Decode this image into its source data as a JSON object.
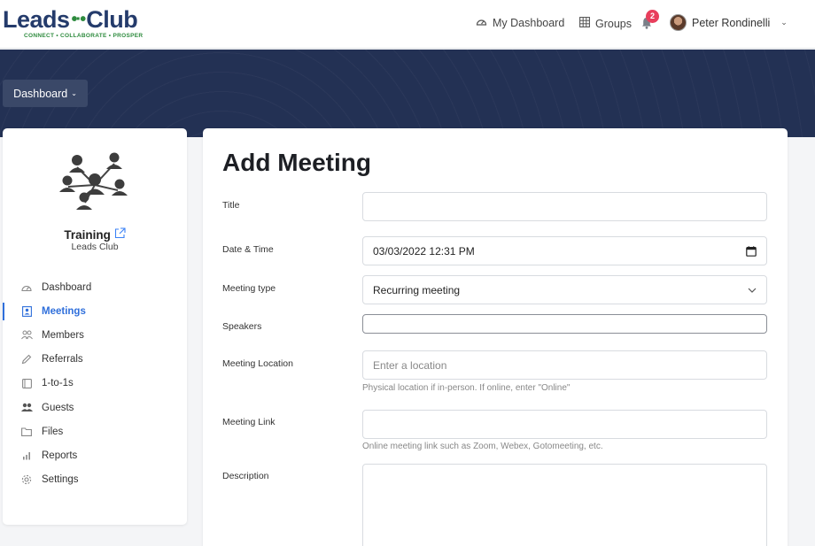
{
  "brand": {
    "name_left": "Leads",
    "name_right": "Club",
    "tagline": "CONNECT • COLLABORATE • PROSPER"
  },
  "topnav": {
    "dashboard_label": "My Dashboard",
    "groups_label": "Groups",
    "notification_count": "2",
    "user_name": "Peter Rondinelli"
  },
  "hero": {
    "dashboard_button": "Dashboard"
  },
  "sidebar": {
    "group_name": "Training",
    "group_sub": "Leads Club",
    "items": [
      {
        "label": "Dashboard",
        "icon": "gauge-icon"
      },
      {
        "label": "Meetings",
        "icon": "meeting-icon"
      },
      {
        "label": "Members",
        "icon": "members-icon"
      },
      {
        "label": "Referrals",
        "icon": "pencil-icon"
      },
      {
        "label": "1-to-1s",
        "icon": "square-icon"
      },
      {
        "label": "Guests",
        "icon": "guests-icon"
      },
      {
        "label": "Files",
        "icon": "folder-icon"
      },
      {
        "label": "Reports",
        "icon": "bar-chart-icon"
      },
      {
        "label": "Settings",
        "icon": "gear-icon"
      }
    ],
    "active_item": "Meetings"
  },
  "form": {
    "heading": "Add Meeting",
    "title_label": "Title",
    "title_value": "",
    "datetime_label": "Date & Time",
    "datetime_value": "03/03/2022 12:31 PM",
    "type_label": "Meeting type",
    "type_value": "Recurring meeting",
    "speakers_label": "Speakers",
    "speakers_value": "",
    "location_label": "Meeting Location",
    "location_placeholder": "Enter a location",
    "location_help": "Physical location if in-person. If online, enter \"Online\"",
    "link_label": "Meeting Link",
    "link_value": "",
    "link_help": "Online meeting link such as Zoom, Webex, Gotomeeting, etc.",
    "description_label": "Description",
    "description_value": ""
  }
}
